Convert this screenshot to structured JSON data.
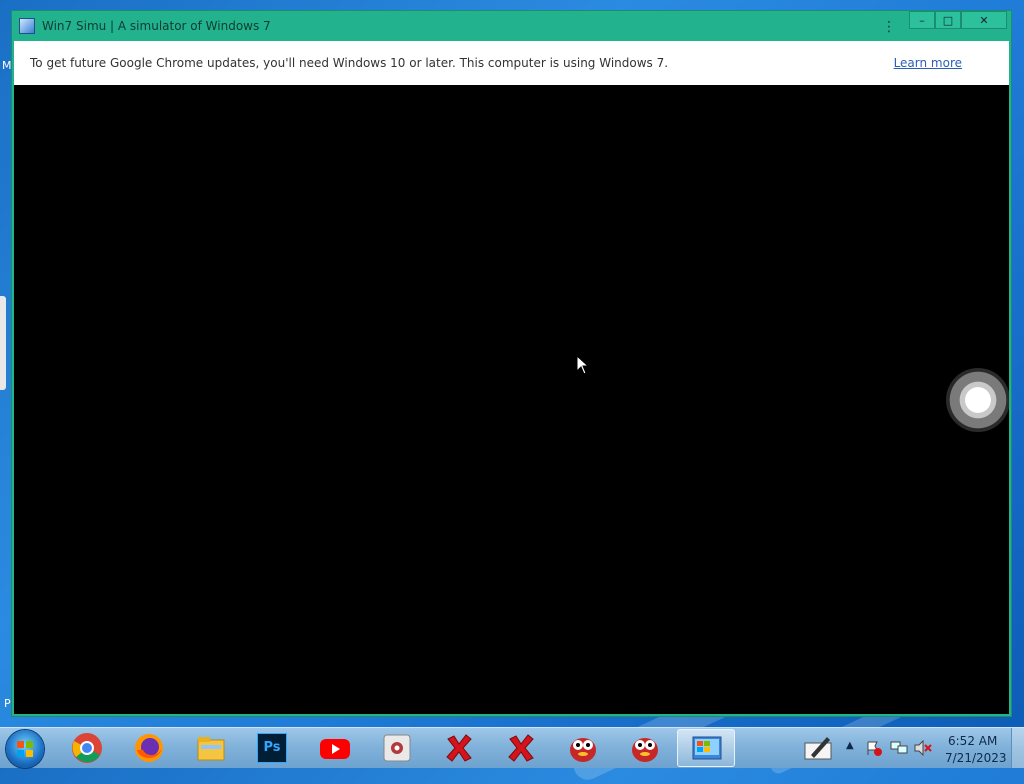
{
  "window": {
    "title": "Win7 Simu | A simulator of Windows 7",
    "menu_icon": "kebab-menu-icon",
    "buttons": {
      "minimize": "–",
      "maximize": "□",
      "close": "✕"
    }
  },
  "infobar": {
    "message": "To get future Google Chrome updates, you'll need Windows 10 or later. This computer is using Windows 7.",
    "link": "Learn more"
  },
  "desktop": {
    "edge_letter_top": "M",
    "edge_letter_bottom": "P"
  },
  "taskbar": {
    "apps": [
      {
        "name": "chrome-icon"
      },
      {
        "name": "firefox-icon"
      },
      {
        "name": "file-explorer-icon"
      },
      {
        "name": "photoshop-icon",
        "label": "Ps"
      },
      {
        "name": "youtube-icon"
      },
      {
        "name": "app-icon"
      },
      {
        "name": "red-x-icon"
      },
      {
        "name": "red-x-icon"
      },
      {
        "name": "mascot-icon"
      },
      {
        "name": "mascot-icon"
      },
      {
        "name": "win7-simu-icon"
      }
    ],
    "clock": {
      "time": "6:52 AM",
      "date": "7/21/2023"
    }
  },
  "colors": {
    "window_frame": "#23b28e",
    "content_bg": "#000000",
    "link": "#2c5fb5"
  }
}
